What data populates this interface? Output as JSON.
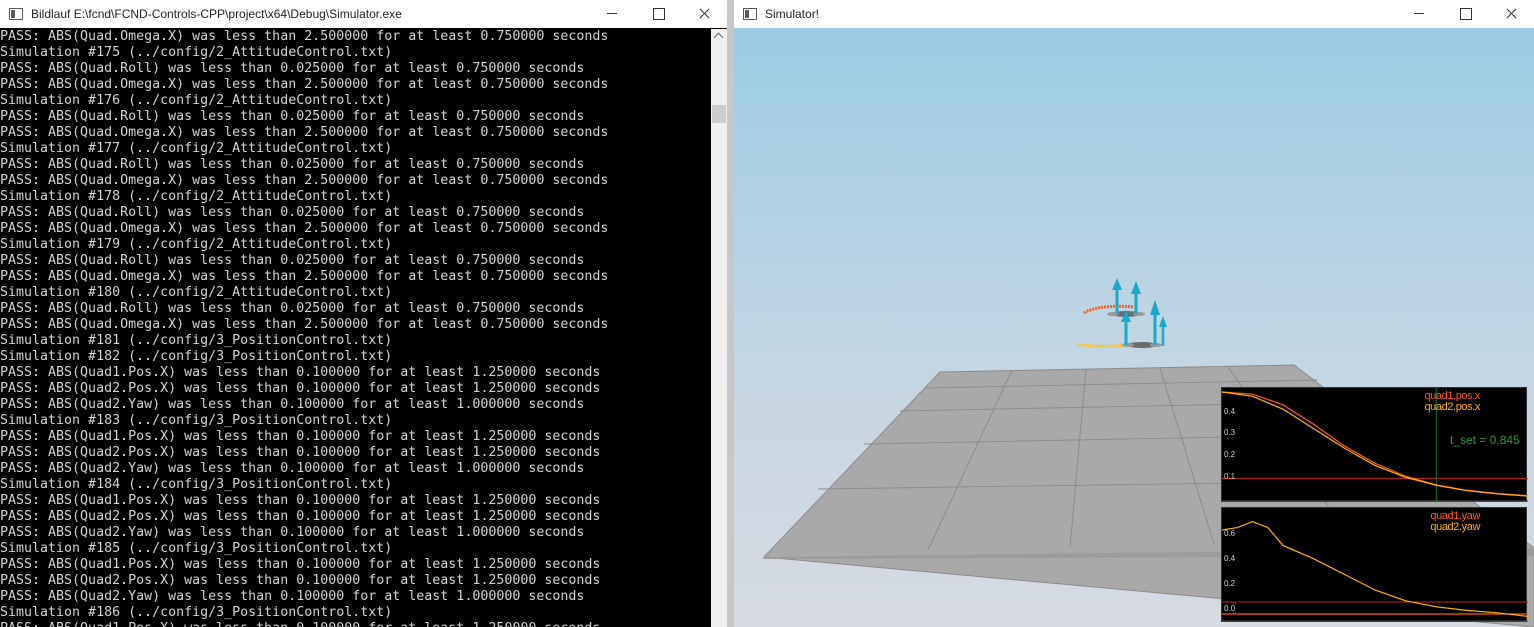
{
  "console": {
    "title": "Bildlauf E:\\fcnd\\FCND-Controls-CPP\\project\\x64\\Debug\\Simulator.exe",
    "lines": [
      "PASS: ABS(Quad.Omega.X) was less than 2.500000 for at least 0.750000 seconds",
      "Simulation #175 (../config/2_AttitudeControl.txt)",
      "PASS: ABS(Quad.Roll) was less than 0.025000 for at least 0.750000 seconds",
      "PASS: ABS(Quad.Omega.X) was less than 2.500000 for at least 0.750000 seconds",
      "Simulation #176 (../config/2_AttitudeControl.txt)",
      "PASS: ABS(Quad.Roll) was less than 0.025000 for at least 0.750000 seconds",
      "PASS: ABS(Quad.Omega.X) was less than 2.500000 for at least 0.750000 seconds",
      "Simulation #177 (../config/2_AttitudeControl.txt)",
      "PASS: ABS(Quad.Roll) was less than 0.025000 for at least 0.750000 seconds",
      "PASS: ABS(Quad.Omega.X) was less than 2.500000 for at least 0.750000 seconds",
      "Simulation #178 (../config/2_AttitudeControl.txt)",
      "PASS: ABS(Quad.Roll) was less than 0.025000 for at least 0.750000 seconds",
      "PASS: ABS(Quad.Omega.X) was less than 2.500000 for at least 0.750000 seconds",
      "Simulation #179 (../config/2_AttitudeControl.txt)",
      "PASS: ABS(Quad.Roll) was less than 0.025000 for at least 0.750000 seconds",
      "PASS: ABS(Quad.Omega.X) was less than 2.500000 for at least 0.750000 seconds",
      "Simulation #180 (../config/2_AttitudeControl.txt)",
      "PASS: ABS(Quad.Roll) was less than 0.025000 for at least 0.750000 seconds",
      "PASS: ABS(Quad.Omega.X) was less than 2.500000 for at least 0.750000 seconds",
      "Simulation #181 (../config/3_PositionControl.txt)",
      "Simulation #182 (../config/3_PositionControl.txt)",
      "PASS: ABS(Quad1.Pos.X) was less than 0.100000 for at least 1.250000 seconds",
      "PASS: ABS(Quad2.Pos.X) was less than 0.100000 for at least 1.250000 seconds",
      "PASS: ABS(Quad2.Yaw) was less than 0.100000 for at least 1.000000 seconds",
      "Simulation #183 (../config/3_PositionControl.txt)",
      "PASS: ABS(Quad1.Pos.X) was less than 0.100000 for at least 1.250000 seconds",
      "PASS: ABS(Quad2.Pos.X) was less than 0.100000 for at least 1.250000 seconds",
      "PASS: ABS(Quad2.Yaw) was less than 0.100000 for at least 1.000000 seconds",
      "Simulation #184 (../config/3_PositionControl.txt)",
      "PASS: ABS(Quad1.Pos.X) was less than 0.100000 for at least 1.250000 seconds",
      "PASS: ABS(Quad2.Pos.X) was less than 0.100000 for at least 1.250000 seconds",
      "PASS: ABS(Quad2.Yaw) was less than 0.100000 for at least 1.000000 seconds",
      "Simulation #185 (../config/3_PositionControl.txt)",
      "PASS: ABS(Quad1.Pos.X) was less than 0.100000 for at least 1.250000 seconds",
      "PASS: ABS(Quad2.Pos.X) was less than 0.100000 for at least 1.250000 seconds",
      "PASS: ABS(Quad2.Yaw) was less than 0.100000 for at least 1.000000 seconds",
      "Simulation #186 (../config/3_PositionControl.txt)",
      "PASS: ABS(Quad1.Pos.X) was less than 0.100000 for at least 1.250000 seconds"
    ]
  },
  "simulator": {
    "title": "Simulator!"
  },
  "colors": {
    "console_bg": "#000000",
    "console_text": "#d4d4d4",
    "quad1": "#ff5b1c",
    "quad2": "#ffb400",
    "threshold_line": "#c02a10",
    "tset_marker": "#2a9a3a",
    "floor": "#a8a8a8",
    "quad_arrow": "#1aa9c8"
  },
  "plots": {
    "position": {
      "legend1": "quad1.pos.x",
      "legend2": "quad2.pos.x",
      "yticks": [
        "0.4",
        "0.3",
        "0.2",
        "0.1"
      ],
      "tset_label": "t_set = 0.845",
      "threshold": 0.1
    },
    "yaw": {
      "legend1": "quad1.yaw",
      "legend2": "quad2.yaw",
      "yticks": [
        "0.6",
        "0.4",
        "0.2",
        "0.0"
      ],
      "threshold": 0.1
    }
  },
  "chart_data": [
    {
      "type": "line",
      "x": [
        0.0,
        0.1,
        0.2,
        0.3,
        0.4,
        0.5,
        0.6,
        0.7,
        0.8,
        0.9,
        1.0
      ],
      "series": [
        {
          "name": "quad1.pos.x",
          "values": [
            0.5,
            0.49,
            0.44,
            0.35,
            0.25,
            0.17,
            0.11,
            0.07,
            0.045,
            0.03,
            0.02
          ]
        },
        {
          "name": "quad2.pos.x",
          "values": [
            0.5,
            0.48,
            0.42,
            0.33,
            0.24,
            0.16,
            0.105,
            0.068,
            0.043,
            0.028,
            0.018
          ]
        }
      ],
      "ylim": [
        0.0,
        0.5
      ],
      "threshold": 0.1
    },
    {
      "type": "line",
      "x": [
        0.0,
        0.05,
        0.1,
        0.15,
        0.2,
        0.3,
        0.4,
        0.5,
        0.6,
        0.7,
        0.8,
        0.9,
        1.0
      ],
      "series": [
        {
          "name": "quad1.yaw",
          "values": [
            0.0,
            0.0,
            0.0,
            0.0,
            0.0,
            0.0,
            0.0,
            0.0,
            0.0,
            0.0,
            0.0,
            0.0,
            0.0
          ]
        },
        {
          "name": "quad2.yaw",
          "values": [
            0.7,
            0.72,
            0.77,
            0.72,
            0.57,
            0.46,
            0.33,
            0.2,
            0.11,
            0.06,
            0.03,
            0.01,
            -0.02
          ]
        }
      ],
      "ylim": [
        -0.05,
        0.85
      ],
      "threshold": 0.1
    }
  ]
}
